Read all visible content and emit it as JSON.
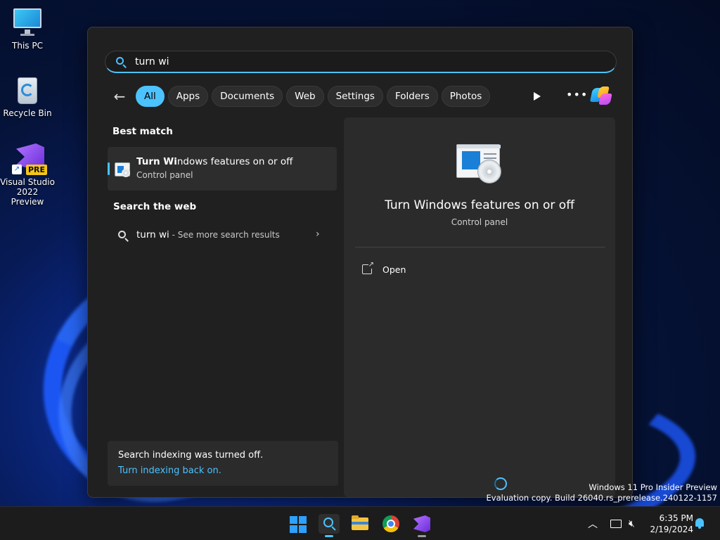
{
  "desktop": {
    "icons": [
      {
        "label": "This PC"
      },
      {
        "label": "Recycle Bin"
      },
      {
        "label": "Visual Studio 2022 Preview",
        "badge": "PRE"
      }
    ]
  },
  "search": {
    "query": "turn wi",
    "filters": [
      "All",
      "Apps",
      "Documents",
      "Web",
      "Settings",
      "Folders",
      "Photos"
    ],
    "active_filter": "All"
  },
  "results": {
    "best_match_heading": "Best match",
    "best_match": {
      "title_bold": "Turn Wi",
      "title_rest": "ndows features on or off",
      "subtitle": "Control panel"
    },
    "web_heading": "Search the web",
    "web_result": {
      "query": "turn wi",
      "suffix": " - See more search results"
    },
    "indexing": {
      "message": "Search indexing was turned off.",
      "link": "Turn indexing back on."
    }
  },
  "preview": {
    "title": "Turn Windows features on or off",
    "subtitle": "Control panel",
    "actions": [
      {
        "label": "Open",
        "icon": "open-external-icon"
      }
    ]
  },
  "watermark": {
    "line1": "Windows 11 Pro Insider Preview",
    "line2": "Evaluation copy. Build 26040.rs_prerelease.240122-1157"
  },
  "taskbar": {
    "apps": [
      "start-icon",
      "search-icon",
      "file-explorer-icon",
      "chrome-icon",
      "visual-studio-icon"
    ],
    "time": "6:35 PM",
    "date": "2/19/2024"
  },
  "colors": {
    "accent": "#4cc2ff",
    "panel_bg": "#202020",
    "preview_bg": "#2b2b2b"
  }
}
